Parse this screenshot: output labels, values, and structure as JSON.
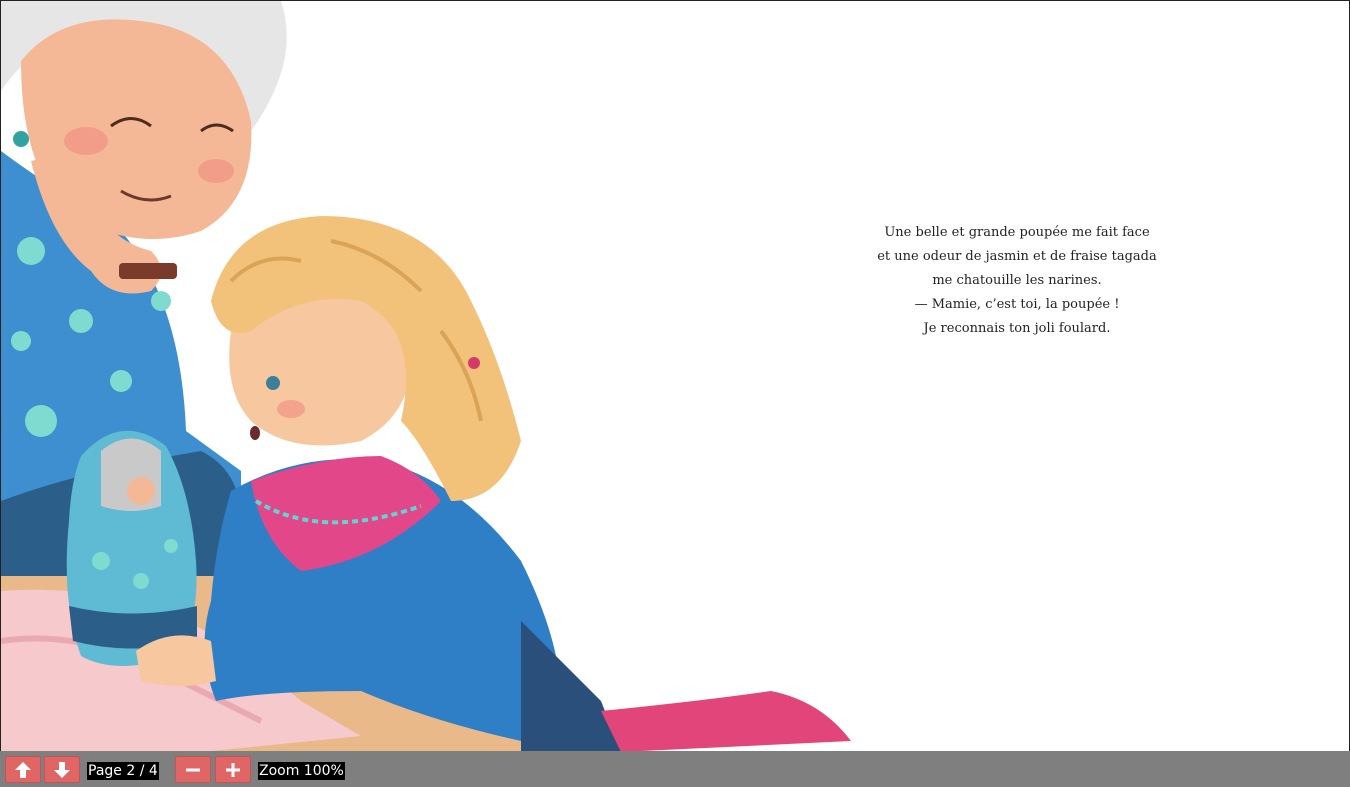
{
  "story": {
    "lines": [
      "Une belle et grande poupée me fait face",
      "et une odeur de jasmin et de fraise tagada",
      "me chatouille les narines.",
      "— Mamie, c’est toi, la poupée !",
      "Je reconnais ton joli foulard."
    ]
  },
  "illustration": {
    "description_icons": [
      "grandmother",
      "girl",
      "matryoshka-doll",
      "table"
    ]
  },
  "toolbar": {
    "prev_icon": "arrow-up-icon",
    "next_icon": "arrow-down-icon",
    "page_label": "Page 2 / 4",
    "zoom_out_icon": "minus-icon",
    "zoom_in_icon": "plus-icon",
    "zoom_label": "Zoom 100%"
  },
  "colors": {
    "button": "#e06666",
    "toolbar": "#7f7f7f",
    "label_bg": "#000000"
  }
}
